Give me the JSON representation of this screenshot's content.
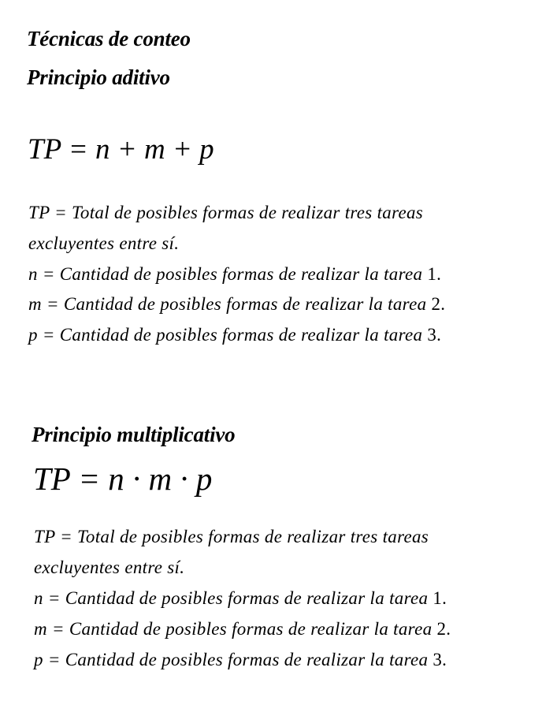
{
  "section1": {
    "title": "Técnicas de conteo",
    "subtitle": "Principio aditivo",
    "formula": "TP = n + m + p",
    "defs": [
      {
        "pre": "TP =  Total de posibles formas de realizar tres tareas",
        "num": ""
      },
      {
        "pre": "excluyentes entre sí.",
        "num": ""
      },
      {
        "pre": "n = Cantidad de posibles formas de realizar la tarea ",
        "num": "1."
      },
      {
        "pre": "m = Cantidad de posibles formas de realizar la tarea ",
        "num": "2."
      },
      {
        "pre": "p = Cantidad de posibles formas de realizar la tarea ",
        "num": "3."
      }
    ]
  },
  "section2": {
    "title": "Principio multiplicativo",
    "formula": "TP = n · m · p",
    "defs": [
      {
        "pre": "TP =  Total de posibles formas de realizar tres tareas",
        "num": ""
      },
      {
        "pre": "excluyentes entre sí.",
        "num": ""
      },
      {
        "pre": "n = Cantidad de posibles formas de realizar la tarea ",
        "num": "1."
      },
      {
        "pre": "m = Cantidad de posibles formas de realizar la tarea ",
        "num": "2."
      },
      {
        "pre": "p = Cantidad de posibles formas de realizar la tarea ",
        "num": "3."
      }
    ]
  }
}
